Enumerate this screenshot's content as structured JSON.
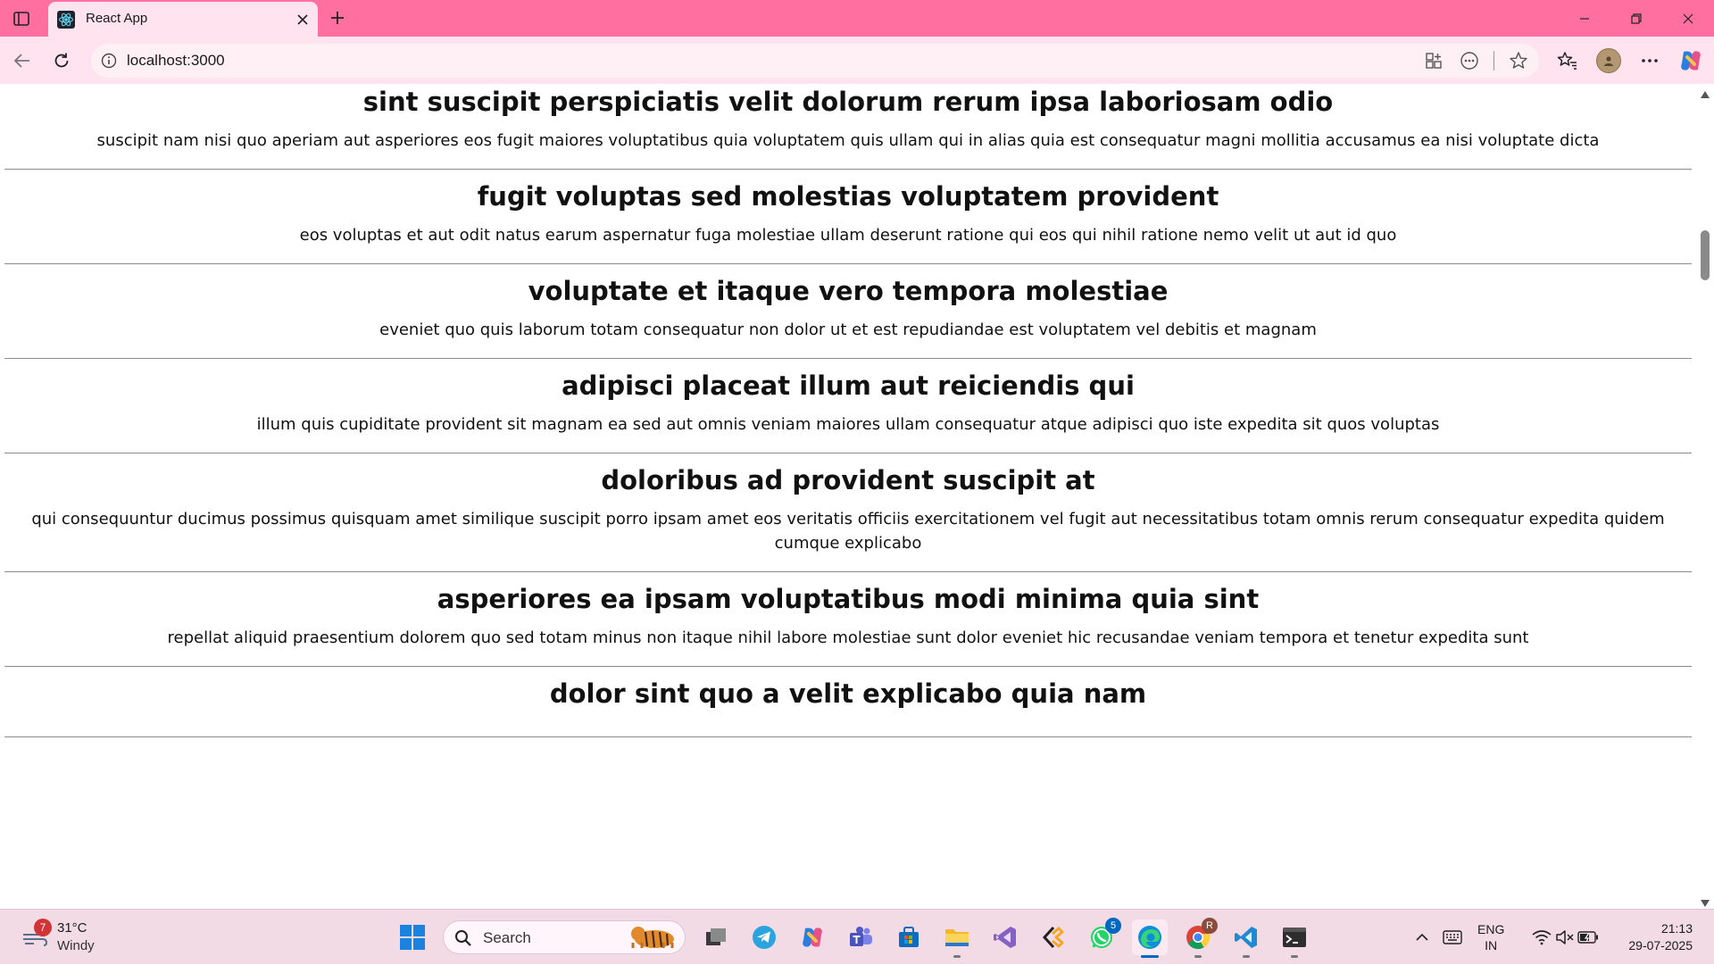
{
  "browser": {
    "tab_title": "React App",
    "url": "localhost:3000"
  },
  "posts": [
    {
      "title": "sint suscipit perspiciatis velit dolorum rerum ipsa laboriosam odio",
      "body": "suscipit nam nisi quo aperiam aut asperiores eos fugit maiores voluptatibus quia voluptatem quis ullam qui in alias quia est consequatur magni mollitia accusamus ea nisi voluptate dicta"
    },
    {
      "title": "fugit voluptas sed molestias voluptatem provident",
      "body": "eos voluptas et aut odit natus earum aspernatur fuga molestiae ullam deserunt ratione qui eos qui nihil ratione nemo velit ut aut id quo"
    },
    {
      "title": "voluptate et itaque vero tempora molestiae",
      "body": "eveniet quo quis laborum totam consequatur non dolor ut et est repudiandae est voluptatem vel debitis et magnam"
    },
    {
      "title": "adipisci placeat illum aut reiciendis qui",
      "body": "illum quis cupiditate provident sit magnam ea sed aut omnis veniam maiores ullam consequatur atque adipisci quo iste expedita sit quos voluptas"
    },
    {
      "title": "doloribus ad provident suscipit at",
      "body": "qui consequuntur ducimus possimus quisquam amet similique suscipit porro ipsam amet eos veritatis officiis exercitationem vel fugit aut necessitatibus totam omnis rerum consequatur expedita quidem cumque explicabo"
    },
    {
      "title": "asperiores ea ipsam voluptatibus modi minima quia sint",
      "body": "repellat aliquid praesentium dolorem quo sed totam minus non itaque nihil labore molestiae sunt dolor eveniet hic recusandae veniam tempora et tenetur expedita sunt"
    },
    {
      "title": "dolor sint quo a velit explicabo quia nam",
      "body": ""
    }
  ],
  "taskbar": {
    "weather_temp": "31°C",
    "weather_condition": "Windy",
    "weather_badge": "7",
    "search_placeholder": "Search",
    "whatsapp_badge": "5",
    "chrome_badge": "R",
    "lang_line1": "ENG",
    "lang_line2": "IN",
    "time": "21:13",
    "date": "29-07-2025"
  },
  "colors": {
    "tabstrip": "#ff6fa0",
    "toolbar": "#ffe3ee",
    "taskbar": "#f3dbe6",
    "accent": "#0067c0"
  }
}
